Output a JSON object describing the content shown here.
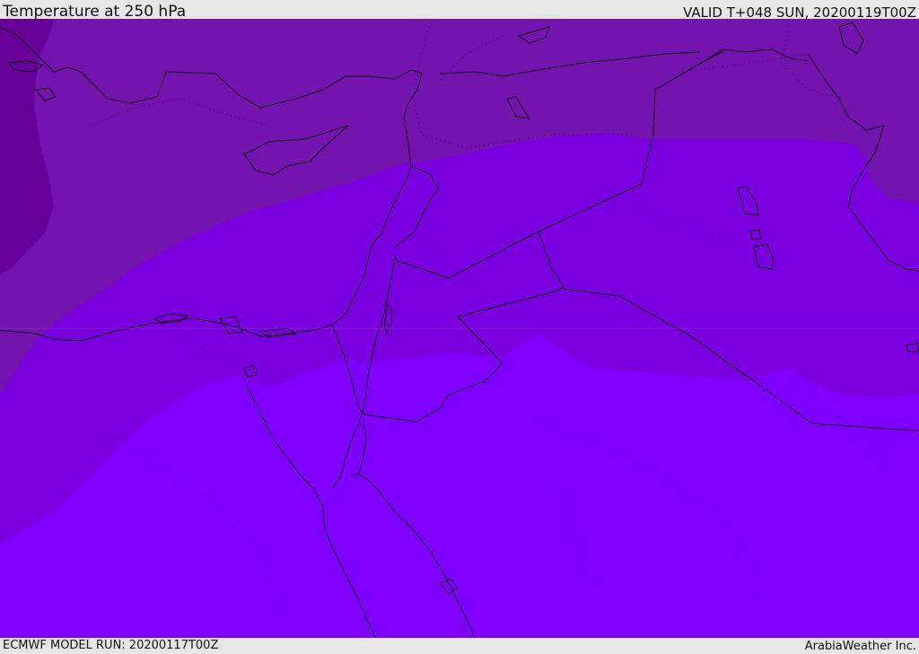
{
  "header": {
    "title": "Temperature at 250 hPa",
    "valid_label": "VALID T+048 SUN, 20200119T00Z"
  },
  "footer": {
    "model_run": "ECMWF MODEL RUN: 20200117T00Z",
    "credit": "ArabiaWeather Inc."
  },
  "map": {
    "colors": {
      "band_coldest": "#660099",
      "band_cold": "#7214ad",
      "band_mid": "#7a00e0",
      "band_warm": "#7f00ff",
      "coastline": "#111111",
      "border": "#222222"
    }
  }
}
